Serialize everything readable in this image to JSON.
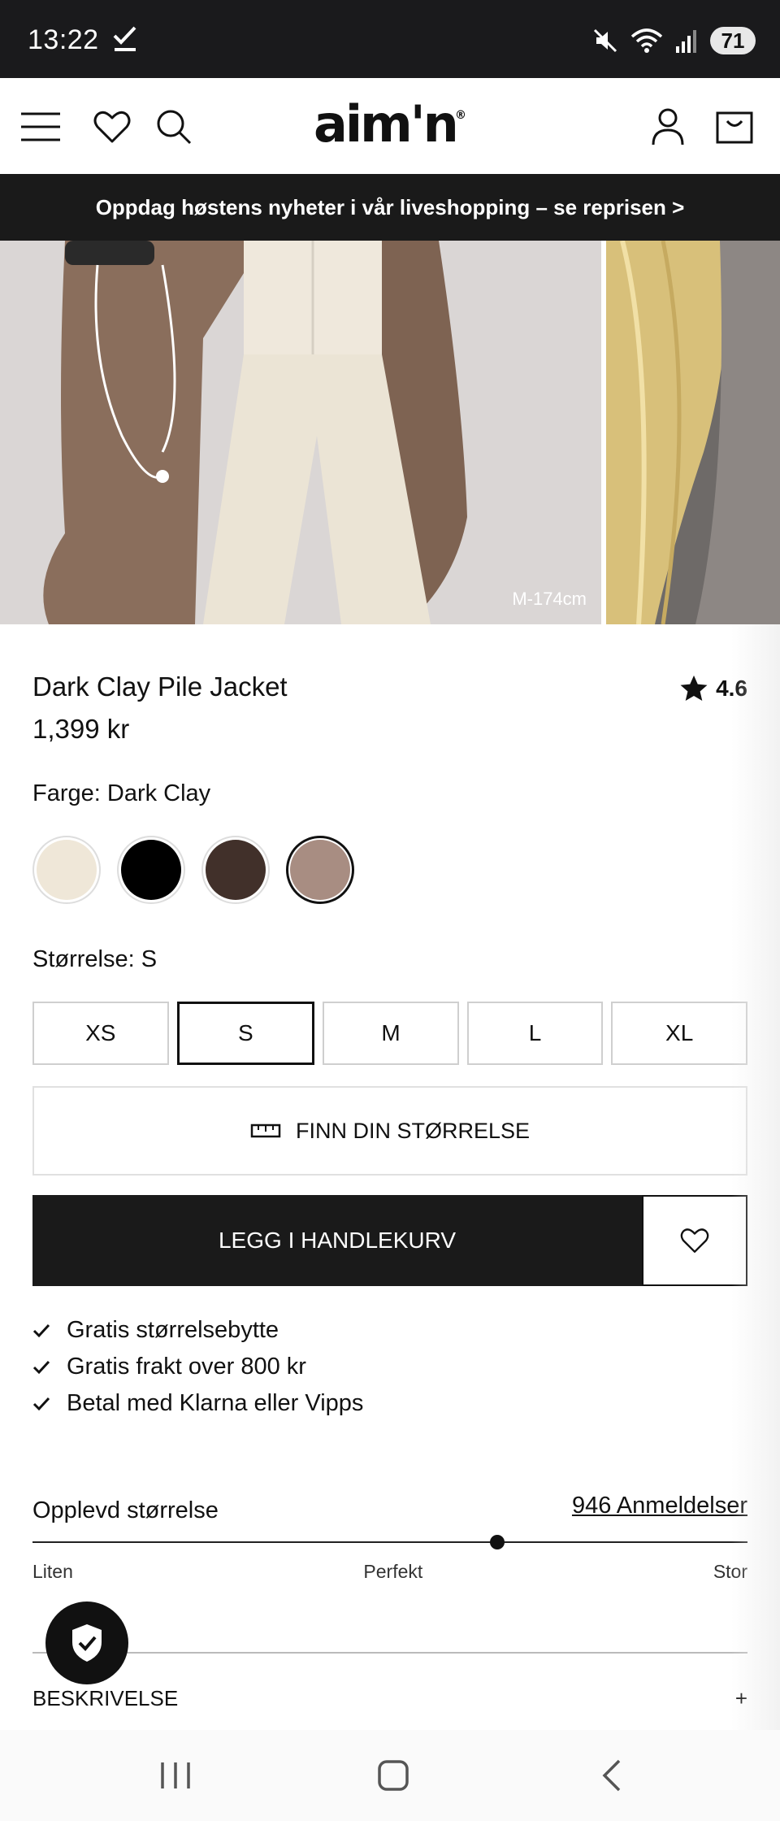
{
  "status_bar": {
    "time": "13:22",
    "battery": "71"
  },
  "header": {
    "logo": "aim'n"
  },
  "promo": {
    "text": "Oppdag høstens nyheter i vår liveshopping – se reprisen >"
  },
  "gallery": {
    "model_label": "M-174cm"
  },
  "product": {
    "title": "Dark Clay Pile Jacket",
    "price": "1,399 kr",
    "rating": "4.6",
    "color_label": "Farge: Dark Clay",
    "colors": [
      {
        "name": "cream",
        "hex": "#efe7d8",
        "selected": false
      },
      {
        "name": "black",
        "hex": "#000000",
        "selected": false
      },
      {
        "name": "brown",
        "hex": "#41302a",
        "selected": false
      },
      {
        "name": "dark-clay",
        "hex": "#a88d82",
        "selected": true
      }
    ],
    "size_label": "Størrelse: S",
    "sizes": [
      {
        "label": "XS",
        "selected": false
      },
      {
        "label": "S",
        "selected": true
      },
      {
        "label": "M",
        "selected": false
      },
      {
        "label": "L",
        "selected": false
      },
      {
        "label": "XL",
        "selected": false
      }
    ],
    "find_size_label": "FINN DIN STØRRELSE",
    "add_to_cart_label": "LEGG I HANDLEKURV"
  },
  "perks": [
    "Gratis størrelsebytte",
    "Gratis frakt over 800 kr",
    "Betal med Klarna eller Vipps"
  ],
  "fit": {
    "title": "Opplevd størrelse",
    "reviews_link": "946 Anmeldelser",
    "labels": [
      "Liten",
      "Perfekt",
      "Stor"
    ],
    "value": 0.65
  },
  "description": {
    "label": "BESKRIVELSE",
    "toggle": "+"
  },
  "colors": {
    "accent": "#1a1a1a",
    "background": "#ffffff"
  }
}
